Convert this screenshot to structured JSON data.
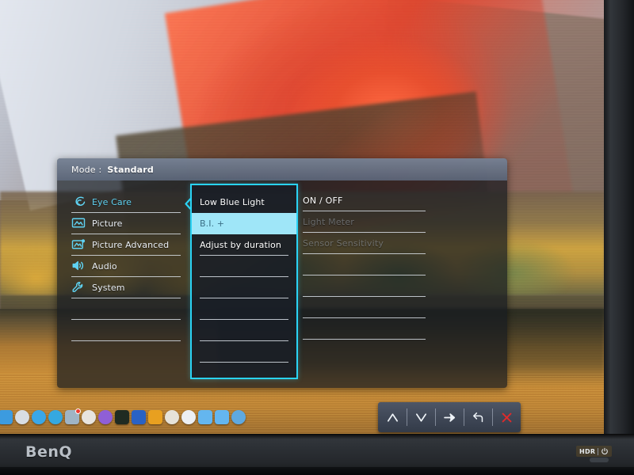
{
  "monitor": {
    "brand_logo": "BenQ",
    "hdr_badge": "HDR",
    "power_icon": "power-icon"
  },
  "desktop": {
    "wallpaper_description": "macOS High Sierra mountain with autumn foliage and lake",
    "dock": {
      "items": [
        {
          "name": "finder-icon",
          "color": "#3c9bdf"
        },
        {
          "name": "launchpad-icon",
          "color": "#d8dde3"
        },
        {
          "name": "safari-icon",
          "color": "#3aa7e8"
        },
        {
          "name": "telegram-icon",
          "color": "#35a8e0"
        },
        {
          "name": "mail-icon",
          "color": "#9fb4c4",
          "badge": true
        },
        {
          "name": "chrome-icon",
          "color": "#e8e4df"
        },
        {
          "name": "steam-icon",
          "color": "#8f5fd6"
        },
        {
          "name": "terminal-icon",
          "color": "#1f2b22"
        },
        {
          "name": "word-icon",
          "color": "#2a62c4"
        },
        {
          "name": "sublime-icon",
          "color": "#e8a020"
        },
        {
          "name": "skype-icon",
          "color": "#e6e2d8"
        },
        {
          "name": "appstore-icon",
          "color": "#eceff3"
        },
        {
          "name": "folder-blue-a-icon",
          "color": "#64b6ef"
        },
        {
          "name": "folder-blue-b-icon",
          "color": "#64b6ef"
        },
        {
          "name": "trash-icon",
          "color": "#5fa9e0"
        }
      ]
    }
  },
  "osd": {
    "header": {
      "mode_label": "Mode :",
      "mode_value": "Standard"
    },
    "categories": [
      {
        "label": "Eye Care",
        "icon": "eye-care-icon",
        "active": true
      },
      {
        "label": "Picture",
        "icon": "picture-icon",
        "active": false
      },
      {
        "label": "Picture Advanced",
        "icon": "picture-advanced-icon",
        "active": false
      },
      {
        "label": "Audio",
        "icon": "audio-icon",
        "active": false
      },
      {
        "label": "System",
        "icon": "system-icon",
        "active": false
      },
      {
        "label": "",
        "icon": "",
        "active": false
      },
      {
        "label": "",
        "icon": "",
        "active": false
      }
    ],
    "items": [
      {
        "label": "Low Blue Light",
        "state": "selected"
      },
      {
        "label": "B.I. +",
        "state": "highlighted"
      },
      {
        "label": "Adjust by duration",
        "state": "normal"
      },
      {
        "label": "",
        "state": "blank"
      },
      {
        "label": "",
        "state": "blank"
      },
      {
        "label": "",
        "state": "blank"
      },
      {
        "label": "",
        "state": "blank"
      },
      {
        "label": "",
        "state": "blank"
      }
    ],
    "sub_options": [
      {
        "label": "ON / OFF",
        "state": "enabled"
      },
      {
        "label": "Light Meter",
        "state": "disabled"
      },
      {
        "label": "Sensor Sensitivity",
        "state": "disabled"
      },
      {
        "label": "",
        "state": "blank"
      },
      {
        "label": "",
        "state": "blank"
      },
      {
        "label": "",
        "state": "blank"
      },
      {
        "label": "",
        "state": "blank"
      }
    ],
    "colors": {
      "accent": "#2ad3f5",
      "highlight_bg": "#9fe6f8",
      "text": "#ffffff",
      "disabled_text": "#7f8a96",
      "exit_red": "#e02b2b"
    }
  },
  "keybar": {
    "keys": [
      {
        "name": "up-arrow-icon",
        "label": "Up"
      },
      {
        "name": "down-arrow-icon",
        "label": "Down"
      },
      {
        "name": "enter-arrow-icon",
        "label": "Enter"
      },
      {
        "name": "back-arrow-icon",
        "label": "Back"
      },
      {
        "name": "exit-close-icon",
        "label": "Exit"
      }
    ]
  }
}
